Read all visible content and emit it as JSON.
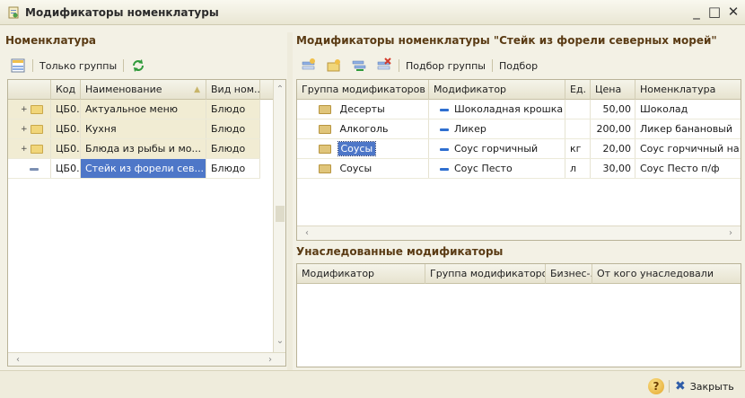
{
  "window": {
    "title": "Модификаторы номенклатуры",
    "min_label": "_",
    "max_label": "□",
    "close_label": "✕"
  },
  "left": {
    "section_title": "Номенклатура",
    "toolbar": {
      "groups_only": "Только группы"
    },
    "columns": [
      "",
      "Код",
      "Наименование",
      "Вид ном..."
    ],
    "rows": [
      {
        "icon": "folder-plus-icon",
        "code": "ЦБ0...",
        "name": "Актуальное меню",
        "kind": "Блюдо"
      },
      {
        "icon": "folder-plus-icon",
        "code": "ЦБ0...",
        "name": "Кухня",
        "kind": "Блюдо"
      },
      {
        "icon": "folder-plus-icon",
        "code": "ЦБ0...",
        "name": "Блюда из рыбы и мо...",
        "kind": "Блюдо"
      },
      {
        "icon": "item-dash-icon",
        "code": "ЦБ0...",
        "name": "Стейк из форели сев...",
        "kind": "Блюдо"
      }
    ]
  },
  "right": {
    "section_title": "Модификаторы номенклатуры \"Стейк из форели северных морей\"",
    "toolbar": {
      "pick_group": "Подбор группы",
      "pick": "Подбор"
    },
    "columns": [
      "Группа модификаторов",
      "Модификатор",
      "Ед.",
      "Цена",
      "Номенклатура"
    ],
    "rows": [
      {
        "group": "Десерты",
        "modifier": "Шоколадная крошка",
        "unit": "",
        "price": "50,00",
        "item": "Шоколад"
      },
      {
        "group": "Алкоголь",
        "modifier": "Ликер",
        "unit": "",
        "price": "200,00",
        "item": "Ликер банановый"
      },
      {
        "group": "Соусы",
        "modifier": "Соус горчичный",
        "unit": "кг",
        "price": "20,00",
        "item": "Соус горчичный на"
      },
      {
        "group": "Соусы",
        "modifier": "Соус Песто",
        "unit": "л",
        "price": "30,00",
        "item": "Соус Песто п/ф"
      }
    ],
    "inherited": {
      "section_title": "Унаследованные модификаторы",
      "columns": [
        "Модификатор",
        "Группа модификаторов",
        "Бизнес-...",
        "От кого унаследовали"
      ]
    }
  },
  "footer": {
    "help": "?",
    "close": "Закрыть"
  }
}
